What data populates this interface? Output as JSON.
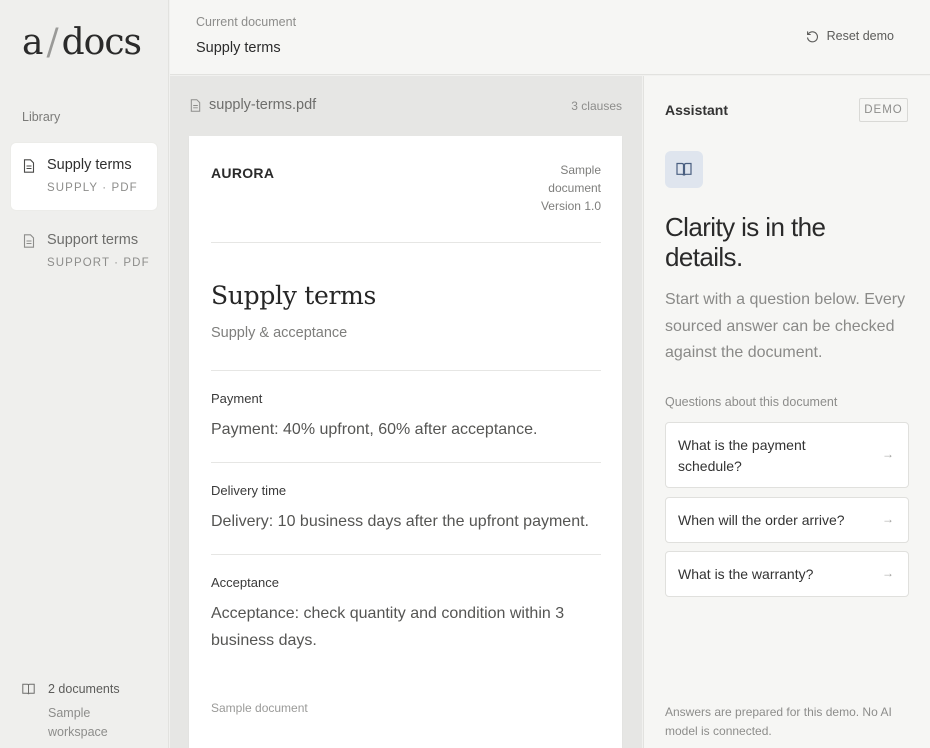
{
  "brand": {
    "logo_a": "a",
    "logo_slash": "/",
    "logo_docs": "docs"
  },
  "sidebar": {
    "library_label": "Library",
    "items": [
      {
        "title": "Supply terms",
        "sub": "SUPPLY · PDF",
        "active": true
      },
      {
        "title": "Support terms",
        "sub": "SUPPORT · PDF",
        "active": false
      }
    ],
    "footer": {
      "count": "2 documents",
      "workspace": "Sample workspace"
    }
  },
  "header": {
    "current_label": "Current document",
    "current_title": "Supply terms",
    "reset_label": "Reset demo"
  },
  "viewer": {
    "filename": "supply-terms.pdf",
    "clauses": "3 clauses",
    "page": {
      "brand": "AURORA",
      "meta_line1": "Sample document",
      "meta_line2": "Version 1.0",
      "title": "Supply terms",
      "subtitle": "Supply & acceptance",
      "clauses": [
        {
          "heading": "Payment",
          "text": "Payment: 40% upfront, 60% after acceptance."
        },
        {
          "heading": "Delivery time",
          "text": "Delivery: 10 business days after the upfront payment."
        },
        {
          "heading": "Acceptance",
          "text": "Acceptance: check quantity and condition within 3 business days."
        }
      ],
      "footer": "Sample document"
    }
  },
  "assistant": {
    "title": "Assistant",
    "badge": "DEMO",
    "headline": "Clarity is in the details.",
    "intro": "Start with a question below. Every sourced answer can be checked against the document.",
    "questions_label": "Questions about this document",
    "questions": [
      {
        "text": "What is the payment schedule?"
      },
      {
        "text": "When will the order arrive?"
      },
      {
        "text": "What is the warranty?"
      }
    ],
    "arrow": "→",
    "footer": "Answers are prepared for this demo. No AI model is connected."
  },
  "colors": {
    "sidebar_bg": "#efefed",
    "viewer_bg": "#e6e6e4",
    "accent_tile": "#dfe5ee",
    "icon_blue": "#4a5f80"
  },
  "icons": [
    "document-icon",
    "book-icon",
    "reset-icon",
    "arrow-right-icon"
  ]
}
